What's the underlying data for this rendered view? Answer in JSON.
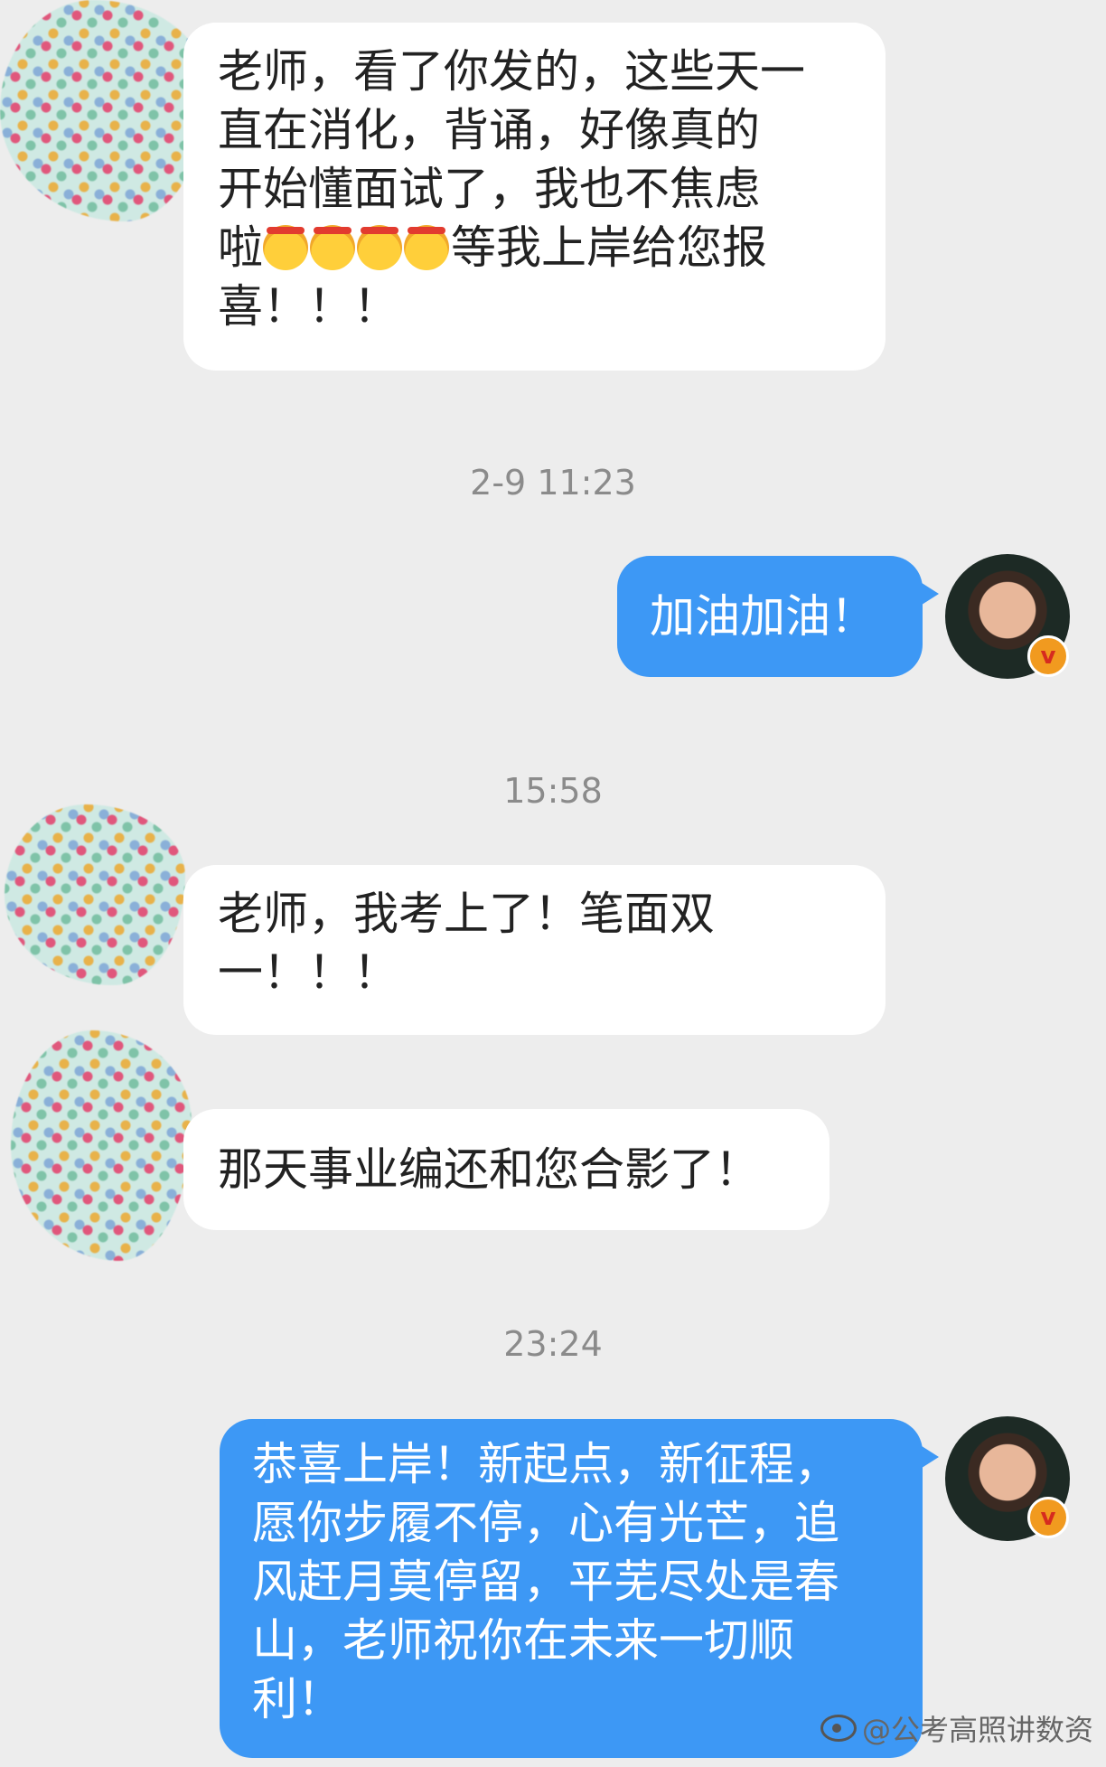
{
  "messages": [
    {
      "text_before_emoji": "老师，看了你发的，这些天一直在消化，背诵，好像真的开始懂面试了，我也不焦虑啦",
      "emoji": "[emoji-headband] x4",
      "text_after_emoji": "等我上岸给您报喜！！！"
    },
    {
      "timestamp": "2-9 11:23"
    },
    {
      "text": "加油加油！"
    },
    {
      "timestamp": "15:58"
    },
    {
      "text": "老师，我考上了！笔面双一！！！"
    },
    {
      "text": "那天事业编还和您合影了！"
    },
    {
      "timestamp": "23:24"
    },
    {
      "text": "恭喜上岸！新起点，新征程，愿你步履不停，心有光芒，追风赶月莫停留，平芜尽处是春山，老师祝你在未来一切顺利！"
    }
  ],
  "labels": {
    "msg1_part1": "老师，看了你发的，这些天一",
    "msg1_part2": "直在消化，背诵，好像真的",
    "msg1_part3": "开始懂面试了，我也不焦虑",
    "msg1_part4a": "啦",
    "msg1_part4b": "等我上岸给您报",
    "msg1_part5": "喜！！！",
    "ts1": "2-9 11:23",
    "msg2": "加油加油！",
    "ts2": "15:58",
    "msg3_line1": "老师，我考上了！笔面双",
    "msg3_line2": "一！！！",
    "msg4": "那天事业编还和您合影了！",
    "ts3": "23:24",
    "msg5_line1": "恭喜上岸！新起点，新征程，",
    "msg5_line2": "愿你步履不停，心有光芒，追",
    "msg5_line3": "风赶月莫停留，平芜尽处是春",
    "msg5_line4": "山，老师祝你在未来一切顺",
    "msg5_line5": "利！",
    "verified_mark": "v",
    "watermark": "@公考高照讲数资"
  },
  "icons": {
    "left_avatar": "polka-dot-avatar",
    "right_avatar": "teacher-photo-avatar",
    "badge": "verified-badge-icon",
    "emoji": "headband-emoji",
    "watermark_logo": "weibo-icon"
  },
  "colors": {
    "background": "#ededed",
    "incoming_bubble": "#ffffff",
    "outgoing_bubble": "#3d98f5",
    "timestamp": "#8b8b8b"
  }
}
